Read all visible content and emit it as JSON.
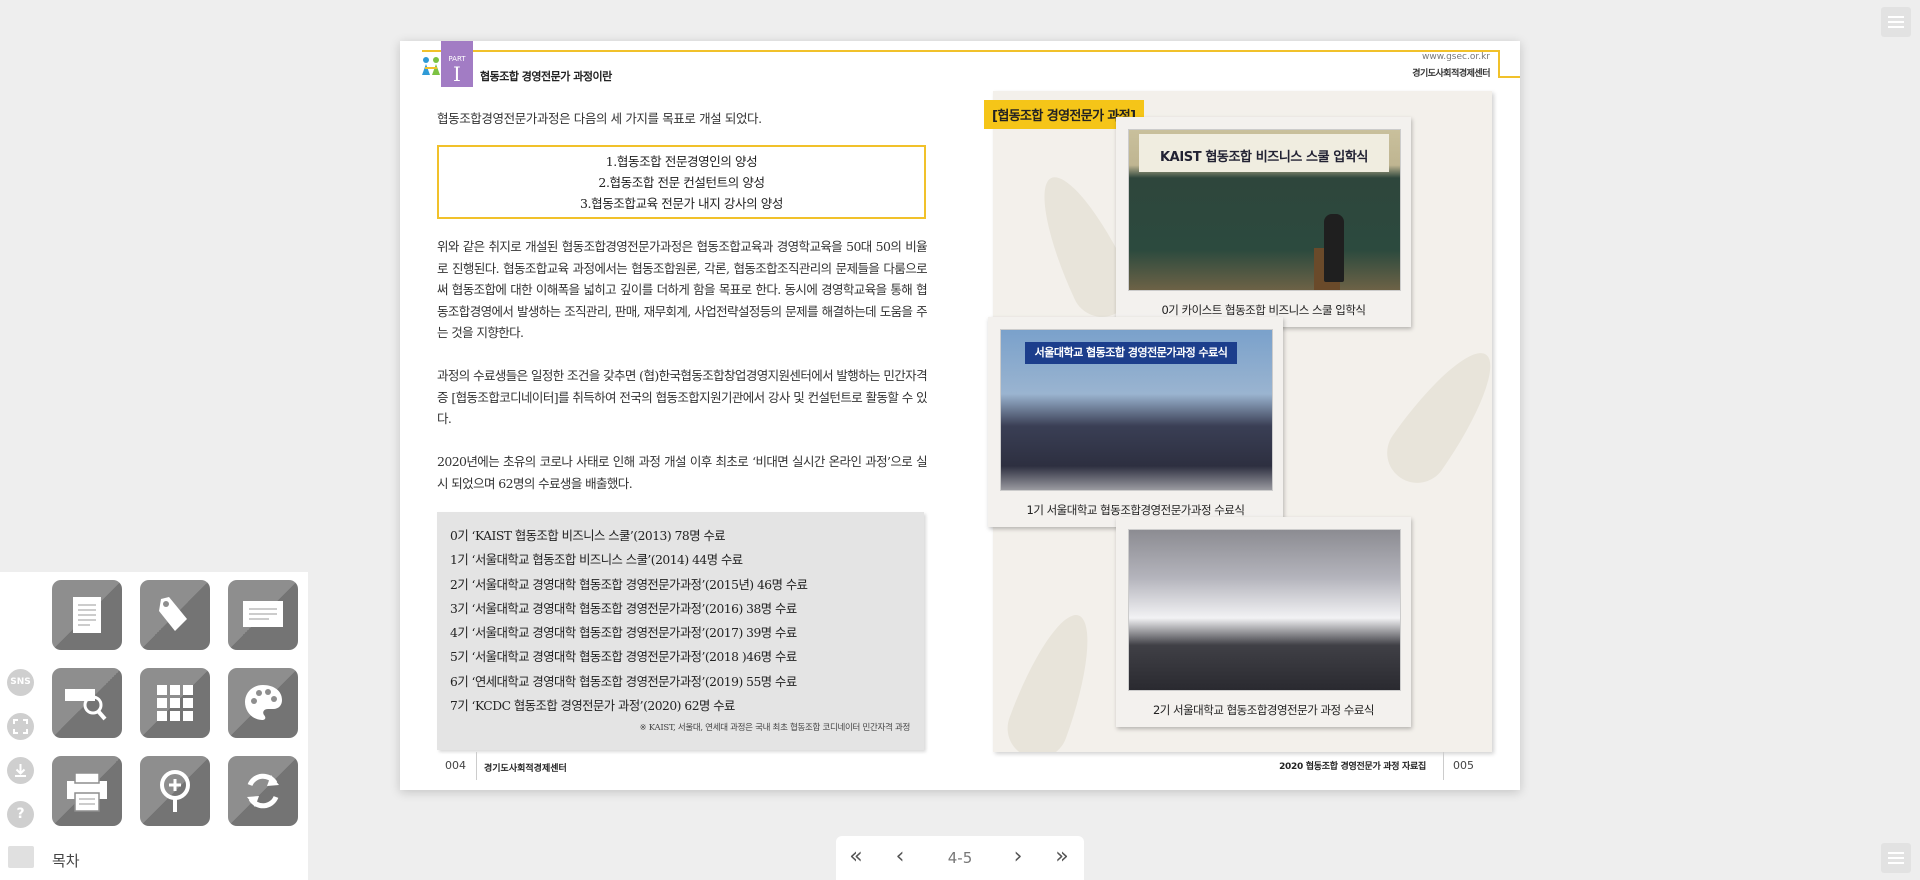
{
  "header": {
    "part_label": "PART",
    "part_number": "I",
    "part_title": "협동조합 경영전문가 과정이란",
    "site_url": "www.gsec.or.kr",
    "site_name": "경기도사회적경제센터"
  },
  "left_page": {
    "intro": "협동조합경영전문가과정은 다음의 세 가지를 목표로 개설 되었다.",
    "goals": [
      "1.협동조합 전문경영인의 양성",
      "2.협동조합 전문 컨설턴트의 양성",
      "3.협동조합교육 전문가 내지 강사의 양성"
    ],
    "para1": "위와 같은 취지로 개설된 협동조합경영전문가과정은 협동조합교육과 경영학교육을 50대 50의 비율로 진행된다. 협동조합교육 과정에서는 협동조합원론, 각론, 협동조합조직관리의 문제들을 다룸으로써 협동조합에 대한 이해폭을 넓히고 깊이를 더하게 함을 목표로 한다. 동시에 경영학교육을 통해 협동조합경영에서 발생하는 조직관리, 판매, 재무회계, 사업전략설정등의 문제를 해결하는데 도움을 주는 것을 지향한다.",
    "para2": "과정의 수료생들은 일정한 조건을 갖추면 (협)한국협동조합창업경영지원센터에서 발행하는 민간자격증 [협동조합코디네이터]를 취득하여 전국의 협동조합지원기관에서 강사 및 컨설턴트로 활동할 수 있다.",
    "para3": "2020년에는  초유의 코로나 사태로 인해 과정 개설 이후 최초로 ‘비대면 실시간 온라인 과정’으로 실시 되었으며 62명의 수료생을 배출했다.",
    "cohorts": [
      "0기  ‘KAIST 협동조합 비즈니스 스쿨’(2013)  78명 수료",
      "1기  ‘서울대학교 협동조합 비즈니스 스쿨’(2014) 44명 수료",
      "2기  ‘서울대학교 경영대학 협동조합 경영전문가과정’(2015년) 46명 수료",
      "3기  ‘서울대학교 경영대학 협동조합 경영전문가과정’(2016) 38명 수료",
      "4기  ‘서울대학교 경영대학 협동조합 경영전문가과정’(2017) 39명 수료",
      "5기  ‘서울대학교 경영대학 협동조합 경영전문가과정’(2018 )46명 수료",
      "6기  ‘연세대학교 경영대학 협동조합 경영전문가과정’(2019) 55명 수료",
      "7기  ‘KCDC 협동조합 경영전문가 과정’(2020) 62명 수료"
    ],
    "note": "※ KAIST, 서울대, 연세대 과정은 국내 최초 협동조합 코디네이터 민간자격 과정",
    "page_number": "004",
    "footer_name": "경기도사회적경제센터"
  },
  "right_page": {
    "tag": "[협동조합 경영전문가 과정]",
    "photos": [
      {
        "caption": "0기 카이스트 협동조합 비즈니스 스쿨 입학식",
        "banner": "KAIST 협동조합 비즈니스 스쿨 입학식"
      },
      {
        "caption": "1기 서울대학교 협동조합경영전문가과정 수료식",
        "banner": "서울대학교 협동조합 경영전문가과정 수료식"
      },
      {
        "caption": "2기 서울대학교 협동조합경영전문가 과정 수료식"
      }
    ],
    "footer_title": "2020 협동조합 경영전문가 과정 자료집",
    "page_number": "005"
  },
  "toolbar": {
    "sns_label": "SNS",
    "toc_label": "목차"
  },
  "pager": {
    "first": "«",
    "prev": "‹",
    "current": "4-5",
    "next": "›",
    "last": "»"
  },
  "colors": {
    "accent_yellow": "#f1c12a",
    "part_purple": "#a27cc4",
    "tile_gray": "#8e8e8e",
    "background": "#eeeeee"
  }
}
